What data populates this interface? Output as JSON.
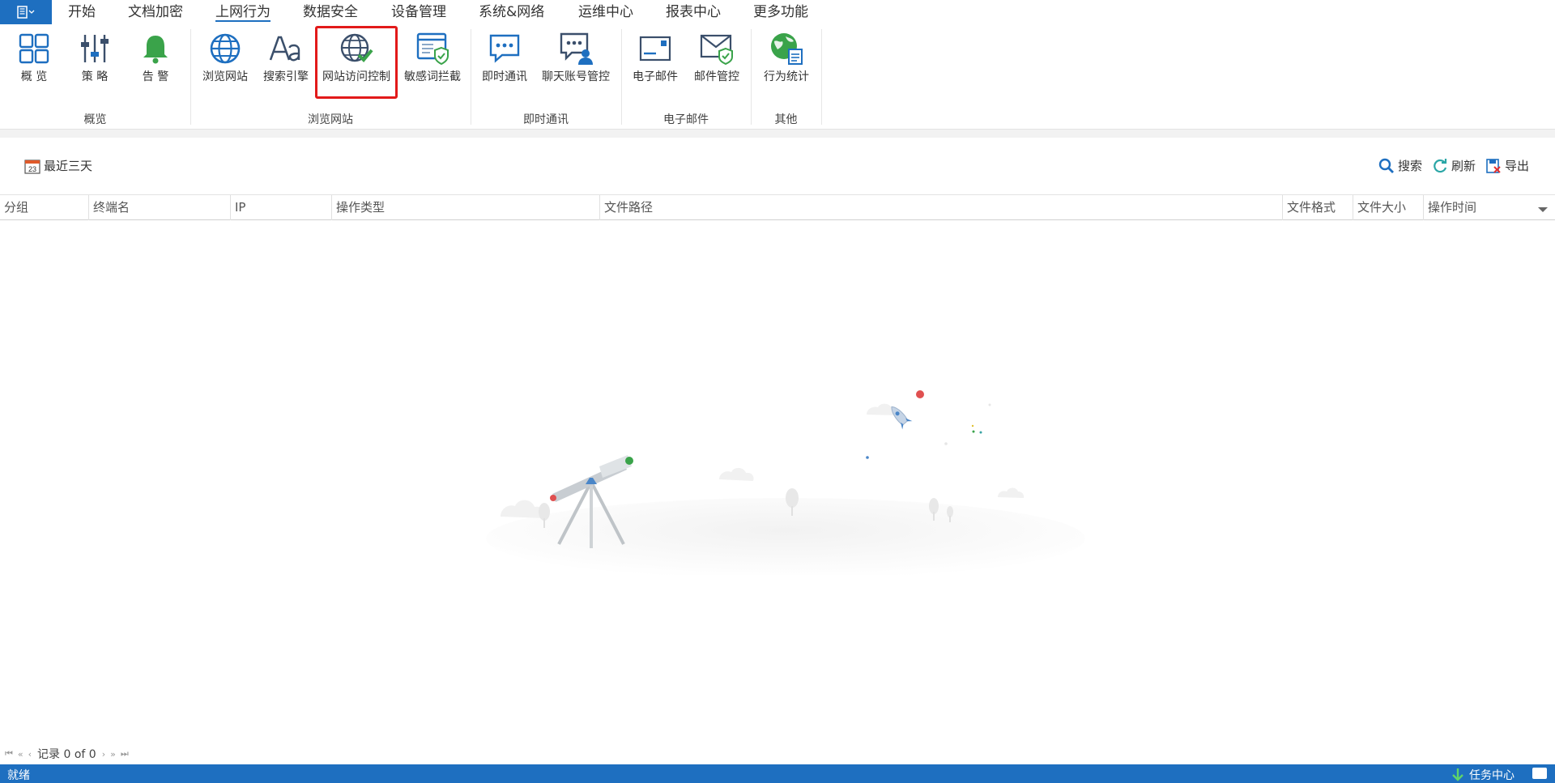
{
  "menubar": {
    "items": [
      "开始",
      "文档加密",
      "上网行为",
      "数据安全",
      "设备管理",
      "系统&网络",
      "运维中心",
      "报表中心",
      "更多功能"
    ],
    "active": "上网行为"
  },
  "ribbon": {
    "groups": {
      "overview": "概览",
      "browse": "浏览网站",
      "im": "即时通讯",
      "email": "电子邮件",
      "other": "其他"
    },
    "buttons": {
      "overview": "概 览",
      "policy": "策 略",
      "alert": "告 警",
      "browse_sites": "浏览网站",
      "search_engine": "搜索引擎",
      "site_access_control": "网站访问控制",
      "sensitive_word_block": "敏感词拦截",
      "im": "即时通讯",
      "chat_account_control": "聊天账号管控",
      "email": "电子邮件",
      "email_control": "邮件管控",
      "behavior_stats": "行为统计"
    },
    "icons": {
      "overview": "grid-icon",
      "policy": "sliders-icon",
      "alert": "bell-icon",
      "browse_sites": "globe-icon",
      "search_engine": "font-aa-icon",
      "site_access_control": "globe-check-icon",
      "sensitive_word_block": "window-shield-icon",
      "im": "chat-bubble-icon",
      "chat_account_control": "chat-user-icon",
      "email": "envelope-icon",
      "email_control": "envelope-shield-icon",
      "behavior_stats": "globe-report-icon"
    }
  },
  "toolbar": {
    "date_range": "最近三天",
    "calendar_day": "23",
    "search": "搜索",
    "refresh": "刷新",
    "export": "导出"
  },
  "table": {
    "columns": [
      "分组",
      "终端名",
      "IP",
      "操作类型",
      "文件路径",
      "文件格式",
      "文件大小",
      "操作时间"
    ],
    "rows": []
  },
  "pager": {
    "record_text": "记录 0 of 0"
  },
  "status": {
    "text": "就绪",
    "task_center": "任务中心"
  },
  "colors": {
    "accent": "#1e6fc0",
    "highlight": "#e21a1a",
    "green": "#3aa34a"
  }
}
